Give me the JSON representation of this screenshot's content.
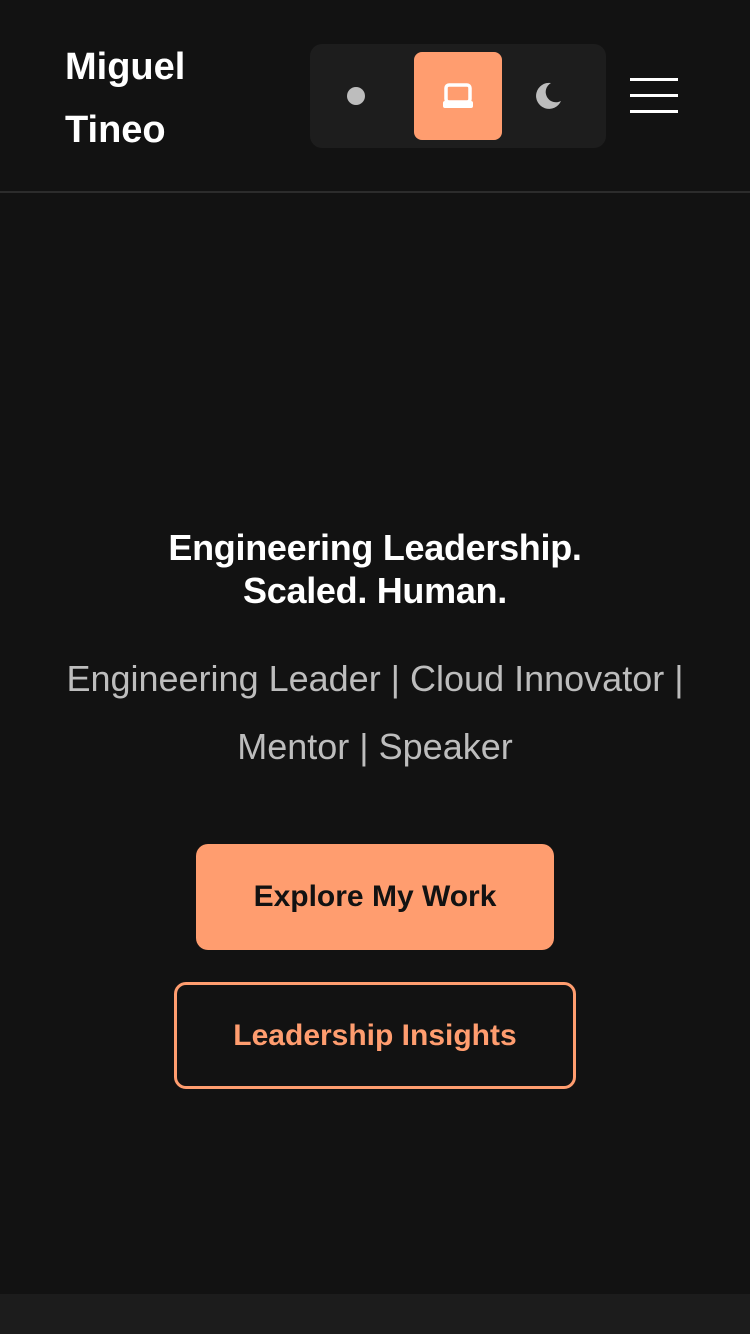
{
  "header": {
    "logo_line1": "Miguel",
    "logo_line2": "Tineo",
    "theme_switch": {
      "options": [
        {
          "id": "light",
          "icon": "dot-icon"
        },
        {
          "id": "system",
          "icon": "laptop-icon",
          "selected": true
        },
        {
          "id": "dark",
          "icon": "moon-icon"
        }
      ]
    },
    "menu_icon": "hamburger-icon"
  },
  "hero": {
    "title_line1": "Engineering Leadership.",
    "title_line2": "Scaled. Human.",
    "subtitle": "Engineering Leader | Cloud Innovator | Mentor | Speaker",
    "primary_cta": "Explore My Work",
    "secondary_cta": "Leadership Insights"
  },
  "colors": {
    "background": "#121212",
    "accent": "#ff9d6f",
    "text": "#ffffff",
    "muted_text": "#bdbdbd"
  }
}
